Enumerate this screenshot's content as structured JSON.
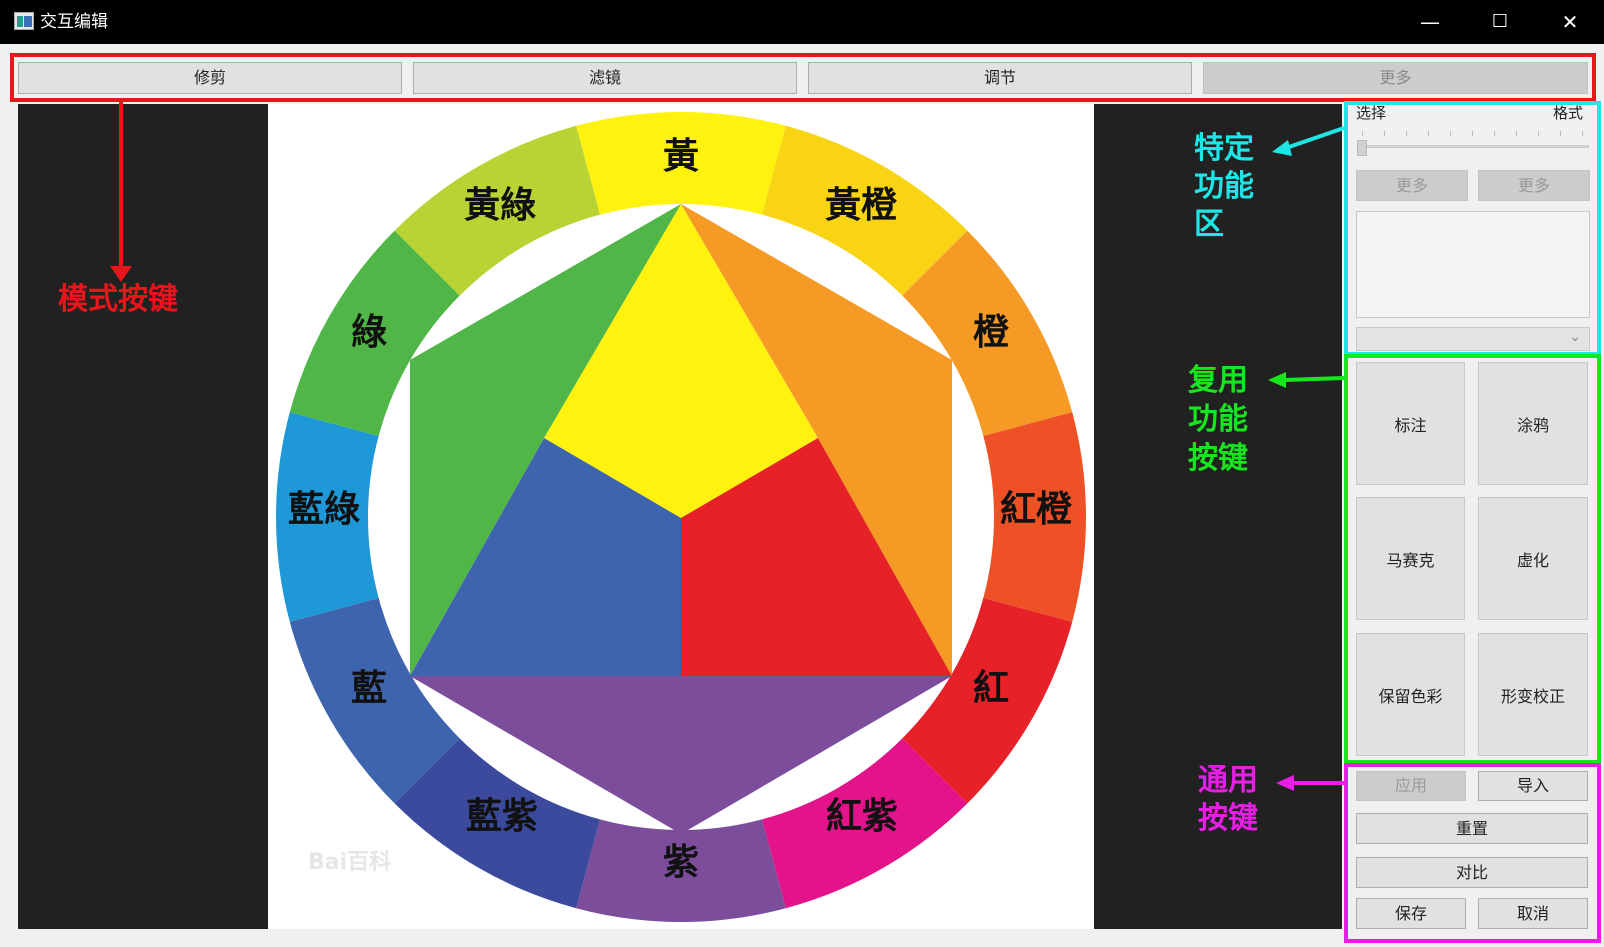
{
  "window": {
    "title": "交互编辑",
    "minimize_glyph": "—",
    "maximize_glyph": "☐",
    "close_glyph": "✕"
  },
  "mode_buttons": [
    {
      "label": "修剪",
      "enabled": true
    },
    {
      "label": "滤镜",
      "enabled": true
    },
    {
      "label": "调节",
      "enabled": true
    },
    {
      "label": "更多",
      "enabled": false
    }
  ],
  "image": {
    "wheel_labels": {
      "yellow": "黃",
      "yellow_orange": "黃橙",
      "orange": "橙",
      "red_orange": "紅橙",
      "red": "紅",
      "red_purple": "紅紫",
      "purple": "紫",
      "blue_purple": "藍紫",
      "blue": "藍",
      "blue_green": "藍綠",
      "green": "綠",
      "yellow_green": "黃綠"
    },
    "watermark": "Bai百科",
    "colors": {
      "yellow": "#fff20f",
      "yellow_orange": "#f8d414",
      "orange": "#f59a24",
      "red_orange": "#ee5126",
      "red": "#e62127",
      "red_purple": "#e3138a",
      "purple": "#7b4d9b",
      "blue_purple": "#3c4a9e",
      "blue": "#3e64ae",
      "blue_green": "#1f98d8",
      "green": "#4fb647",
      "yellow_green": "#b8d334"
    }
  },
  "specific_panel": {
    "select_label": "选择",
    "format_label": "格式",
    "slider_value": 0,
    "more_button_1": "更多",
    "more_button_2": "更多",
    "text_area_value": "",
    "combo_value": "",
    "combo_arrow": "⌄"
  },
  "reuse_buttons": [
    "标注",
    "涂鸦",
    "马赛克",
    "虚化",
    "保留色彩",
    "形变校正"
  ],
  "general_buttons": {
    "apply": "应用",
    "import": "导入",
    "reset": "重置",
    "compare": "对比",
    "save": "保存",
    "cancel": "取消"
  },
  "annotations": {
    "mode_keys": {
      "text": "模式按键",
      "color": "#e8161b"
    },
    "specific_area": {
      "line1": "特定",
      "line2": "功能",
      "line3": "区",
      "color": "#1ee6e6"
    },
    "reuse_keys": {
      "line1": "复用",
      "line2": "功能",
      "line3": "按键",
      "color": "#16e61c"
    },
    "general_keys": {
      "line1": "通用",
      "line2": "按键",
      "color": "#e61ee6"
    }
  }
}
